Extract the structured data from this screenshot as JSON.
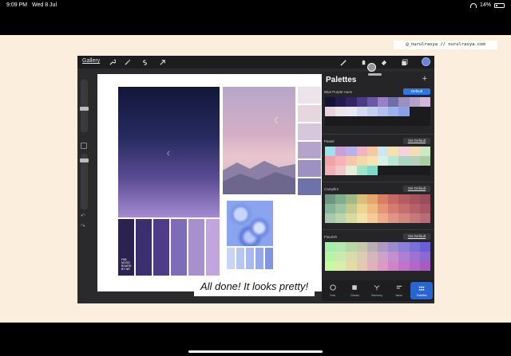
{
  "status_bar": {
    "time": "9:09 PM",
    "date": "Wed 8 Jul",
    "battery": "14%"
  },
  "watermark": "@_nurulrasya // nurulrasya.com",
  "toolbar": {
    "gallery_label": "Gallery",
    "left_tools": [
      "wrench-icon",
      "magic-wand-icon",
      "selection-icon",
      "transform-arrow-icon"
    ],
    "right_tools": [
      "brush-icon",
      "smudge-icon",
      "eraser-icon",
      "layers-icon"
    ],
    "current_color": "#6b83d7"
  },
  "caption": "All done! It looks pretty!",
  "moodboard": {
    "fab_text": [
      "FAB",
      "MOOD",
      "BOARD BY NR"
    ],
    "night_swatches": [
      "#2b2250",
      "#3c2f6f",
      "#4f3c89",
      "#7f6cb8",
      "#a890cf",
      "#c0a6dc"
    ],
    "dusk_swatches": [
      "#ece4ea",
      "#e6d7de",
      "#d6c7dc",
      "#b6a3cc",
      "#9d91c4",
      "#6d73a9"
    ],
    "blue_swatches": [
      "#c9d4f4",
      "#b8c7f2",
      "#a8b9f0",
      "#94a8ec",
      "#8196e2"
    ]
  },
  "panel": {
    "title": "Palettes",
    "add_icon": "plus-icon",
    "palettes": [
      {
        "name": "Blue Purple Hues",
        "button": "Default",
        "active": true,
        "colors": [
          "#141236",
          "#231a4d",
          "#332463",
          "#4b3a86",
          "#6c57a7",
          "#9a7fc6",
          "#6f6ea7",
          "#9c8fbf",
          "#b59fcb",
          "#d1b8da",
          "#ead2df",
          "#efe3ec",
          "#e9e9f5",
          "#d6dbf4",
          "#c5cff2",
          "#b2c0ef",
          "#9eb1ec",
          "#8aa1e6",
          "empty",
          "empty",
          "empty",
          "empty",
          "empty",
          "empty",
          "empty",
          "empty",
          "empty",
          "empty",
          "empty",
          "empty"
        ]
      },
      {
        "name": "Pastel",
        "button": "Set Default",
        "active": false,
        "colors": [
          "#9fe3e8",
          "#c8a2d6",
          "#b8b2e8",
          "#f1b4c6",
          "#f6c7a5",
          "#cfe6ec",
          "#f3e2b4",
          "#f6d1d8",
          "#f4dcb4",
          "#cfe8c3",
          "#f1a3a9",
          "#f7b3b8",
          "#f5c8a9",
          "#f6d8a6",
          "#f6e3b1",
          "#d7f1e7",
          "#b9e7d3",
          "#a9d6c4",
          "#b5d0bc",
          "#aacfa5",
          "#f4b0b7",
          "#f3c6c9",
          "#e3eedb",
          "#9fe6c8",
          "#79dbc8",
          "empty",
          "empty",
          "empty",
          "empty",
          "empty"
        ]
      },
      {
        "name": "Campfire",
        "button": "Set Default",
        "active": false,
        "colors": [
          "#6d9582",
          "#7fae8f",
          "#a3b985",
          "#dcbf7b",
          "#e6a56a",
          "#da7e63",
          "#c86865",
          "#b75b62",
          "#a65460",
          "#9a4c5d",
          "#87b49b",
          "#9cc49e",
          "#c2cb8c",
          "#ead692",
          "#efbb83",
          "#e59575",
          "#d57b72",
          "#c66d6f",
          "#b7626a",
          "#a95766",
          "#a8c9ad",
          "#bad4ae",
          "#d8daa0",
          "#f2e1a5",
          "#f4cb98",
          "#eeac89",
          "#e29587",
          "#d4877f",
          "#c6797a",
          "#b76d75"
        ]
      },
      {
        "name": "Flourish",
        "button": "Set Default",
        "active": false,
        "colors": [
          "#a6efaa",
          "#b3e8ae",
          "#b8d6a8",
          "#c6c8a6",
          "#b9b0b7",
          "#ad9ac1",
          "#9b8bd0",
          "#8b7fd8",
          "#7a6fdb",
          "#6a5fd8",
          "#b6f5a4",
          "#c9ebb0",
          "#d6dcaa",
          "#dacbb2",
          "#d4b6bf",
          "#cda3c9",
          "#c28fd0",
          "#ad80d1",
          "#9c73d2",
          "#8b69cf",
          "#c8f8a0",
          "#d8eeaa",
          "#e2dca8",
          "#e4c8b0",
          "#e1b0bd",
          "#db99c5",
          "#cf84c9",
          "#c173ca",
          "#b366c8",
          "#a55bc2"
        ]
      }
    ],
    "tabs": [
      {
        "label": "Disc",
        "icon": "disc-icon"
      },
      {
        "label": "Classic",
        "icon": "classic-icon"
      },
      {
        "label": "Harmony",
        "icon": "harmony-icon"
      },
      {
        "label": "Value",
        "icon": "value-icon"
      },
      {
        "label": "Palettes",
        "icon": "palettes-icon",
        "active": true
      }
    ]
  }
}
